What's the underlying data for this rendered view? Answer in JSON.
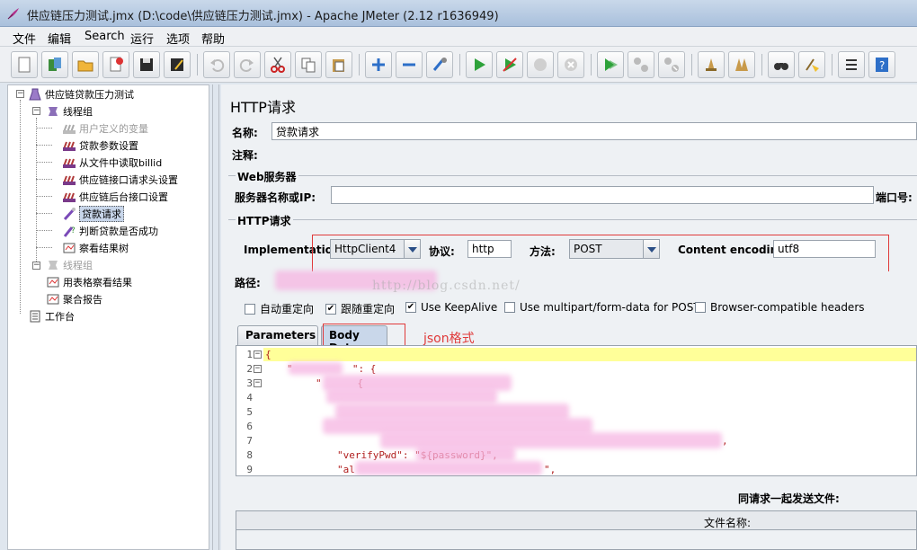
{
  "window": {
    "title": "供应链压力测试.jmx (D:\\code\\供应链压力测试.jmx) - Apache JMeter (2.12 r1636949)"
  },
  "menu": [
    "文件",
    "编辑",
    "Search",
    "运行",
    "选项",
    "帮助"
  ],
  "toolbar": {
    "icons": [
      "new-icon",
      "templates-icon",
      "open-icon",
      "close-icon",
      "save-icon",
      "save-as-icon",
      "undo-icon",
      "redo-icon",
      "cut-icon",
      "copy-icon",
      "paste-icon",
      "expand-icon",
      "collapse-icon",
      "toggle-icon",
      "start-icon",
      "start-no-timers-icon",
      "stop-icon",
      "shutdown-icon",
      "remote-start-icon",
      "remote-stop-icon",
      "remote-shutdown-icon",
      "clear-icon",
      "clear-all-icon",
      "search-icon",
      "reset-search-icon",
      "function-helper-icon",
      "help-icon"
    ]
  },
  "tree": {
    "nodes": [
      {
        "label": "供应链贷款压力测试",
        "icon": "test-plan-icon",
        "disabled": false,
        "selected": false
      },
      {
        "label": "线程组",
        "icon": "thread-group-icon",
        "disabled": false,
        "selected": false
      },
      {
        "label": "用户定义的变量",
        "icon": "config-element-icon",
        "disabled": true,
        "selected": false
      },
      {
        "label": "贷款参数设置",
        "icon": "config-element-icon",
        "disabled": false,
        "selected": false
      },
      {
        "label": "从文件中读取billid",
        "icon": "config-element-icon",
        "disabled": false,
        "selected": false
      },
      {
        "label": "供应链接口请求头设置",
        "icon": "config-element-icon",
        "disabled": false,
        "selected": false
      },
      {
        "label": "供应链后台接口设置",
        "icon": "config-element-icon",
        "disabled": false,
        "selected": false
      },
      {
        "label": "贷款请求",
        "icon": "sampler-icon",
        "disabled": false,
        "selected": true
      },
      {
        "label": "判断贷款是否成功",
        "icon": "assertion-icon",
        "disabled": false,
        "selected": false
      },
      {
        "label": "察看结果树",
        "icon": "listener-icon",
        "disabled": false,
        "selected": false
      },
      {
        "label": "线程组",
        "icon": "thread-group-icon",
        "disabled": true,
        "selected": false
      },
      {
        "label": "用表格察看结果",
        "icon": "listener-icon",
        "disabled": false,
        "selected": false
      },
      {
        "label": "聚合报告",
        "icon": "listener-icon",
        "disabled": false,
        "selected": false
      },
      {
        "label": "工作台",
        "icon": "workbench-icon",
        "disabled": false,
        "selected": false
      }
    ]
  },
  "panel": {
    "title": "HTTP请求",
    "name_label": "名称:",
    "name_value": "贷款请求",
    "comment_label": "注释:",
    "web_server_group": "Web服务器",
    "server_label": "服务器名称或IP:",
    "server_value": "",
    "port_label": "端口号:",
    "http_request_group": "HTTP请求",
    "implementation_label": "Implementation:",
    "implementation_value": "HttpClient4",
    "protocol_label": "协议:",
    "protocol_value": "http",
    "method_label": "方法:",
    "method_value": "POST",
    "encoding_label": "Content encoding:",
    "encoding_value": "utf8",
    "path_label": "路径:",
    "path_value": "",
    "watermark": "http://blog.csdn.net/",
    "checkboxes": [
      {
        "label": "自动重定向",
        "checked": false
      },
      {
        "label": "跟随重定向",
        "checked": true
      },
      {
        "label": "Use KeepAlive",
        "checked": true
      },
      {
        "label": "Use multipart/form-data for POST",
        "checked": false
      },
      {
        "label": "Browser-compatible headers",
        "checked": false
      }
    ],
    "tabs": [
      "Parameters",
      "Body Data"
    ],
    "annotation": "json格式",
    "code": {
      "line_numbers": [
        "1",
        "2",
        "3",
        "4",
        "5",
        "6",
        "7",
        "8",
        "9"
      ],
      "lines": [
        "{",
        "\"          \": {",
        "\"      {",
        "",
        "",
        "",
        "",
        "\"verifyPwd\": \"${password}\",",
        "\"al"
      ],
      "line7_tail": ",",
      "line9_tail": "\","
    },
    "files_section_label": "同请求一起发送文件:",
    "files_column": "文件名称:"
  }
}
